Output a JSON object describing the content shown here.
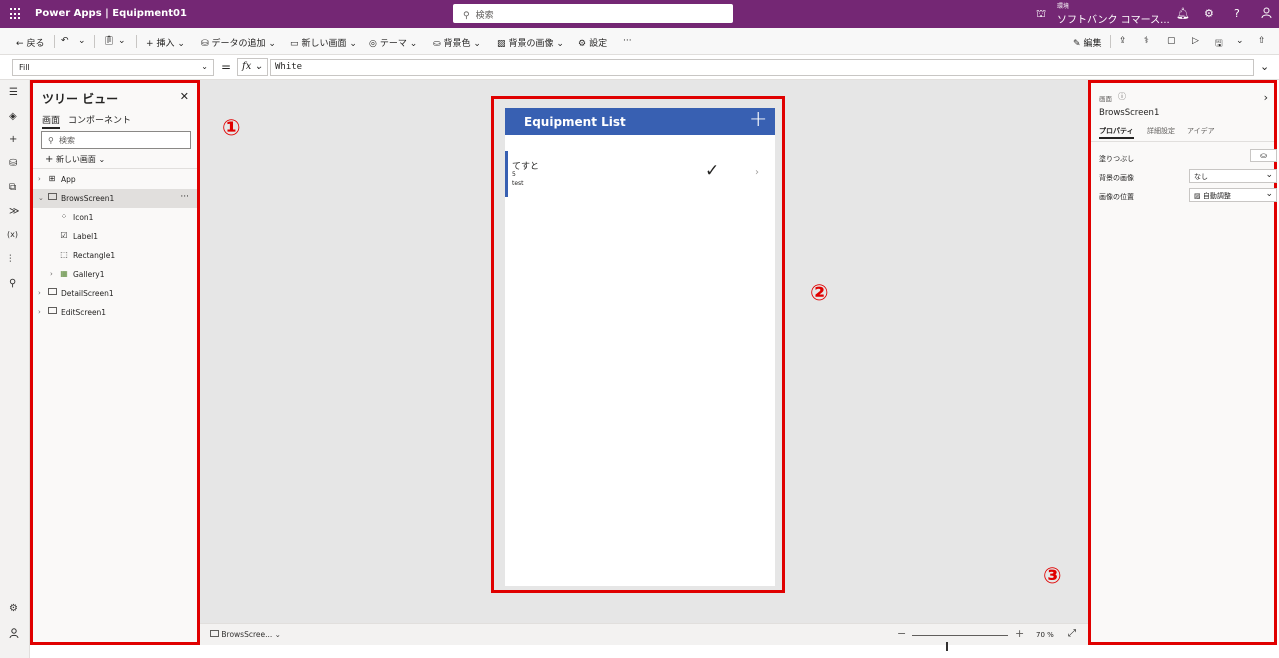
{
  "topbar": {
    "app_title": "Power Apps  |  Equipment01",
    "search_placeholder": "検索",
    "env_label": "環境",
    "env_name": "ソフトバンク コマース..."
  },
  "commands": {
    "back": "戻る",
    "insert": "挿入",
    "add_data": "データの追加",
    "new_screen": "新しい画面",
    "theme": "テーマ",
    "bg_color": "背景色",
    "bg_image": "背景の画像",
    "settings": "設定",
    "more": "···",
    "edit": "編集"
  },
  "formula": {
    "property": "Fill",
    "fx": "fx",
    "value": "White"
  },
  "tree": {
    "title": "ツリー ビュー",
    "tabs": [
      "画面",
      "コンポーネント"
    ],
    "search_placeholder": "検索",
    "new_screen": "新しい画面",
    "rows": [
      {
        "name": "App"
      },
      {
        "name": "BrowsScreen1"
      },
      {
        "name": "Icon1"
      },
      {
        "name": "Label1"
      },
      {
        "name": "Rectangle1"
      },
      {
        "name": "Gallery1"
      },
      {
        "name": "DetailScreen1"
      },
      {
        "name": "EditScreen1"
      }
    ]
  },
  "callouts": [
    "①",
    "②",
    "③"
  ],
  "phone": {
    "title": "Equipment List",
    "add_glyph": "+",
    "item": {
      "title": "てすと",
      "subtitle": "5",
      "body": "test",
      "check": "✓",
      "next": "›"
    }
  },
  "bottombar": {
    "screen": "BrowsScree...",
    "zoom": "70 %",
    "zoom_percent": 70
  },
  "props": {
    "type_label": "画面",
    "name": "BrowsScreen1",
    "tabs": [
      "プロパティ",
      "詳細設定",
      "アイデア"
    ],
    "fill_label": "塗りつぶし",
    "bg_image_label": "背景の画像",
    "bg_image_value": "なし",
    "image_pos_label": "画像の位置",
    "image_pos_value": "自動調整"
  },
  "colors": {
    "brand_purple": "#742774",
    "header_blue": "#3860b2",
    "callout_red": "#e00000"
  }
}
